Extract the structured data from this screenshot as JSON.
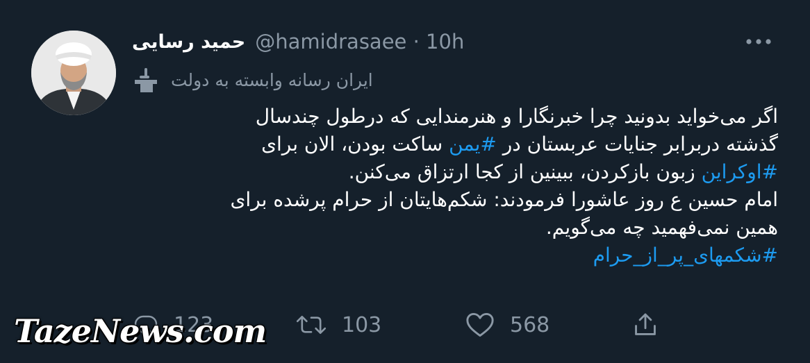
{
  "user": {
    "display_name": "حمید رسایی",
    "handle_time": "@hamidrasaee · 10h"
  },
  "label": {
    "icon": "state-media-podium-icon",
    "text": "ایران رسانه وابسته به دولت"
  },
  "tweet": {
    "line1": "اگر می‌خواید بدونید چرا خبرنگارا و هنرمندایی که درطول چندسال",
    "line2_before": "گذشته دربرابر جنایات عربستان در ",
    "line2_tag": "#یمن",
    "line2_after": " ساکت بودن، الان برای",
    "line3_tag": "#اوکراین",
    "line3_after": " زبون بازکردن، ببینین از کجا ارتزاق می‌کنن.",
    "line4": "امام حسین ع روز عاشورا فرمودند: شکم‌هایتان از حرام پرشده برای",
    "line5": "همین نمی‌فهمید چه می‌گویم.",
    "line6_tag": "#شکمهای_پر_از_حرام"
  },
  "actions": {
    "reply_count": "123",
    "retweet_count": "103",
    "like_count": "568"
  },
  "watermark": "TazeNews.com",
  "colors": {
    "background": "#15202b",
    "text": "#ffffff",
    "secondary": "#8b98a5",
    "accent": "#1d9bf0"
  }
}
